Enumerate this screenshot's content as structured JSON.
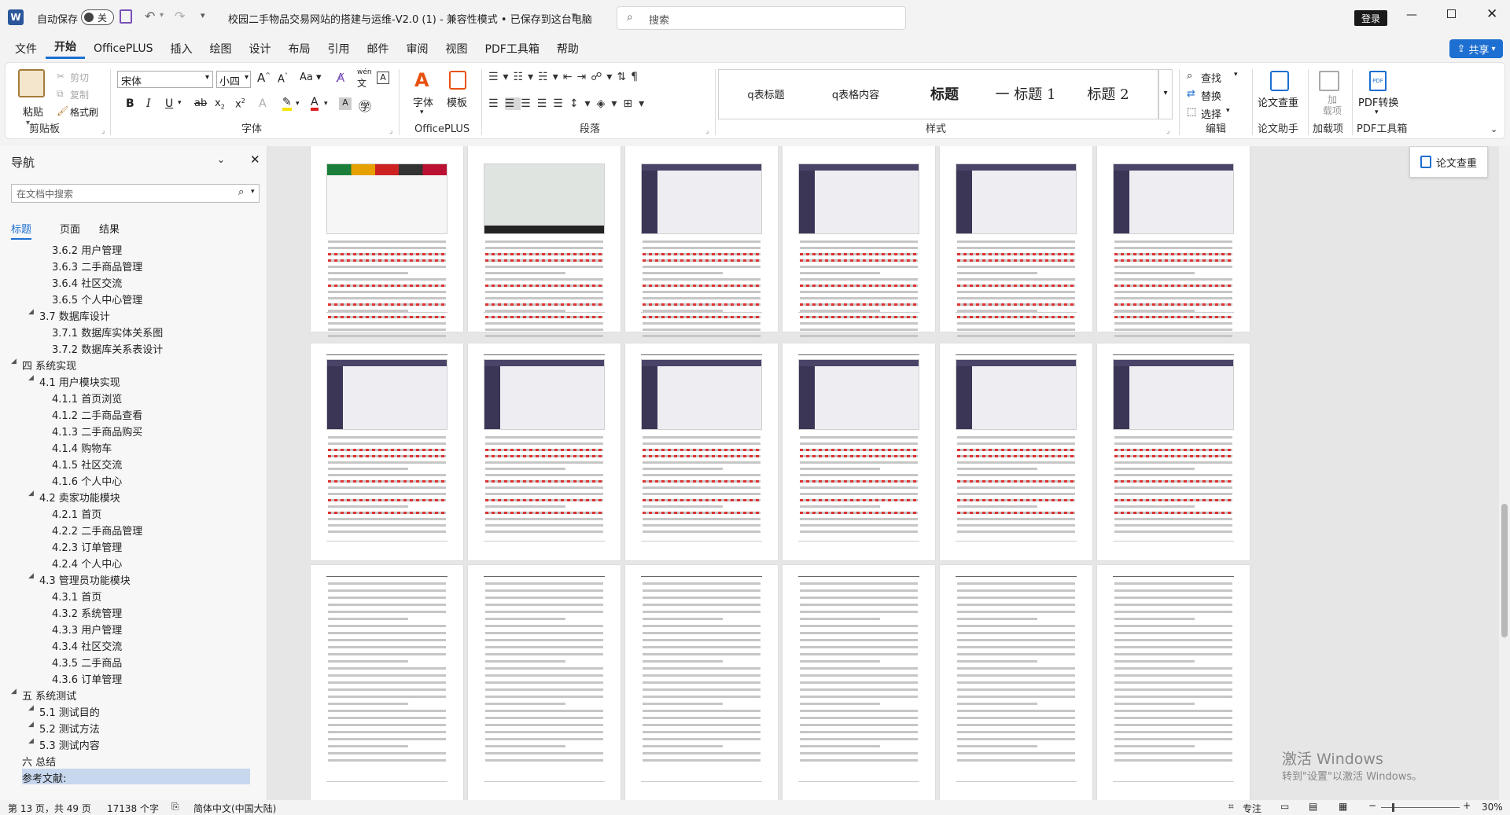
{
  "titlebar": {
    "autosave_label": "自动保存",
    "autosave_state": "关",
    "doc_title": "校园二手物品交易网站的搭建与运维-V2.0 (1)  -  兼容性模式 • 已保存到这台电脑",
    "search_placeholder": "搜索",
    "login_label": "登录"
  },
  "menu": {
    "items": [
      "文件",
      "开始",
      "OfficePLUS",
      "插入",
      "绘图",
      "设计",
      "布局",
      "引用",
      "邮件",
      "审阅",
      "视图",
      "PDF工具箱",
      "帮助"
    ],
    "active": "开始",
    "share_label": "共享"
  },
  "ribbon": {
    "clipboard": {
      "paste": "粘贴",
      "cut": "剪切",
      "copy": "复制",
      "format_painter": "格式刷",
      "label": "剪贴板"
    },
    "font": {
      "name": "宋体",
      "size": "小四",
      "label": "字体",
      "case": "Aa",
      "wen": "wén"
    },
    "officeplus": {
      "font": "字体",
      "template": "模板",
      "label": "OfficePLUS"
    },
    "paragraph": {
      "label": "段落"
    },
    "styles": {
      "items": [
        "q表标题",
        "q表格内容",
        "标题",
        "一 标题 1",
        "标题 2"
      ],
      "label": "样式"
    },
    "editing": {
      "find": "查找",
      "replace": "替换",
      "select": "选择",
      "label": "编辑"
    },
    "thesis": {
      "check": "论文查重",
      "label": "论文助手"
    },
    "addins": {
      "btn": "加\n载项",
      "label": "加载项"
    },
    "pdf": {
      "convert": "PDF转换",
      "label": "PDF工具箱"
    }
  },
  "float_check": "论文查重",
  "nav": {
    "title": "导航",
    "search_placeholder": "在文档中搜索",
    "tabs": [
      "标题",
      "页面",
      "结果"
    ],
    "items": [
      {
        "level": 3,
        "text": "3.6.2 用户管理"
      },
      {
        "level": 3,
        "text": "3.6.3 二手商品管理"
      },
      {
        "level": 3,
        "text": "3.6.4 社区交流"
      },
      {
        "level": 3,
        "text": "3.6.5 个人中心管理"
      },
      {
        "level": 2,
        "text": "3.7 数据库设计"
      },
      {
        "level": 3,
        "text": "3.7.1 数据库实体关系图"
      },
      {
        "level": 3,
        "text": "3.7.2 数据库关系表设计"
      },
      {
        "level": 1,
        "text": "四 系统实现"
      },
      {
        "level": 2,
        "text": "4.1 用户模块实现"
      },
      {
        "level": 3,
        "text": "4.1.1 首页浏览"
      },
      {
        "level": 3,
        "text": "4.1.2 二手商品查看"
      },
      {
        "level": 3,
        "text": "4.1.3 二手商品购买"
      },
      {
        "level": 3,
        "text": "4.1.4 购物车"
      },
      {
        "level": 3,
        "text": "4.1.5 社区交流"
      },
      {
        "level": 3,
        "text": "4.1.6 个人中心"
      },
      {
        "level": 2,
        "text": "4.2 卖家功能模块"
      },
      {
        "level": 3,
        "text": "4.2.1 首页"
      },
      {
        "level": 3,
        "text": "4.2.2 二手商品管理"
      },
      {
        "level": 3,
        "text": "4.2.3 订单管理"
      },
      {
        "level": 3,
        "text": "4.2.4 个人中心"
      },
      {
        "level": 2,
        "text": "4.3 管理员功能模块"
      },
      {
        "level": 3,
        "text": "4.3.1 首页"
      },
      {
        "level": 3,
        "text": "4.3.2 系统管理"
      },
      {
        "level": 3,
        "text": "4.3.3 用户管理"
      },
      {
        "level": 3,
        "text": "4.3.4 社区交流"
      },
      {
        "level": 3,
        "text": "4.3.5 二手商品"
      },
      {
        "level": 3,
        "text": "4.3.6 订单管理"
      },
      {
        "level": 1,
        "text": "五 系统测试"
      },
      {
        "level": 2,
        "text": "5.1 测试目的"
      },
      {
        "level": 2,
        "text": "5.2 测试方法"
      },
      {
        "level": 2,
        "text": "5.3 测试内容"
      },
      {
        "level": 1,
        "text": "六 总结"
      },
      {
        "level": 1,
        "text": "参考文献:"
      }
    ]
  },
  "watermark": {
    "line1": "激活 Windows",
    "line2": "转到\"设置\"以激活 Windows。"
  },
  "status": {
    "page": "第 13 页，共 49 页",
    "words": "17138 个字",
    "lang": "简体中文(中国大陆)",
    "focus": "专注",
    "zoom": "30%"
  }
}
